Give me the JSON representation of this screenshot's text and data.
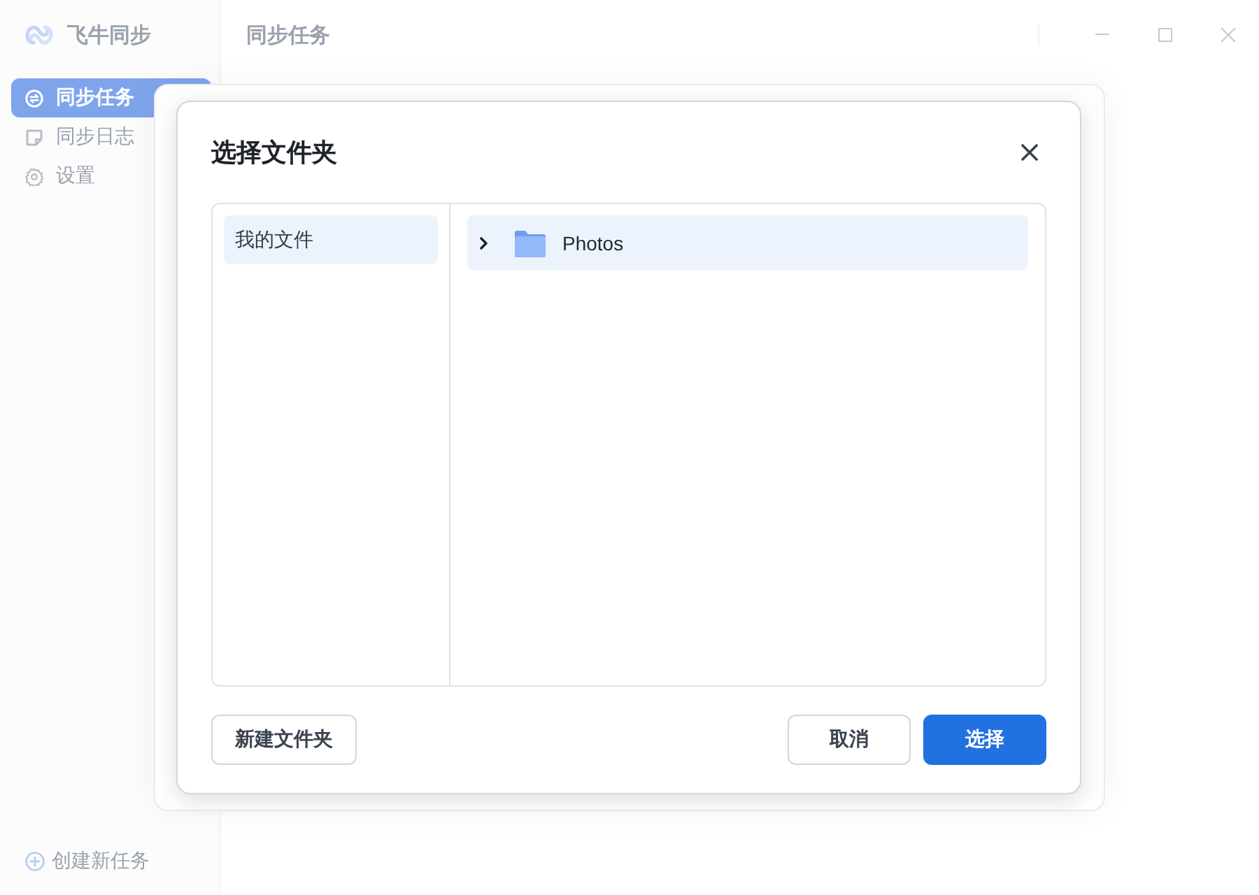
{
  "app": {
    "name": "飞牛同步",
    "page_title": "同步任务"
  },
  "sidebar": {
    "items": [
      {
        "label": "同步任务",
        "kind": "tasks",
        "selected": true
      },
      {
        "label": "同步日志",
        "kind": "log",
        "selected": false
      },
      {
        "label": "设置",
        "kind": "settings",
        "selected": false
      }
    ],
    "create_task": "创建新任务"
  },
  "dialog": {
    "title": "选择文件夹",
    "locations": [
      {
        "label": "我的文件",
        "selected": true
      }
    ],
    "folders": [
      {
        "name": "Photos",
        "selected": true,
        "expanded": false
      }
    ],
    "new_folder_button": "新建文件夹",
    "cancel_button": "取消",
    "confirm_button": "选择"
  }
}
